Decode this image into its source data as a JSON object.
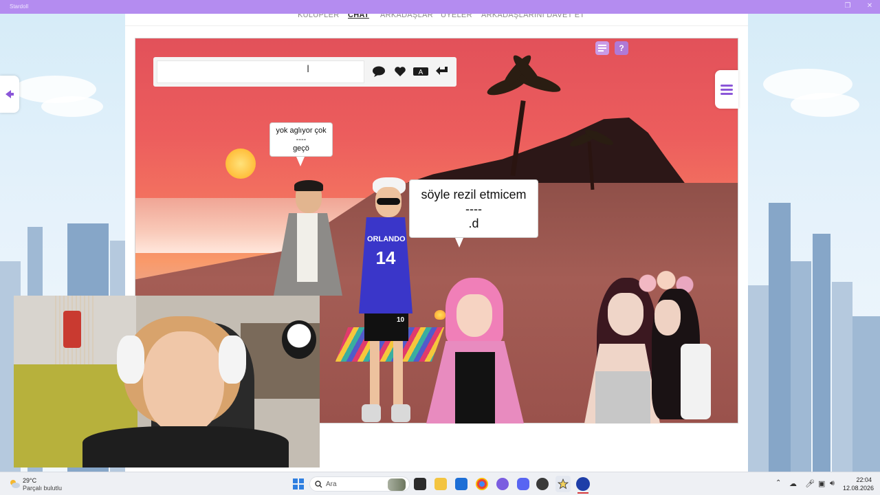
{
  "window": {
    "title": "Stardoll"
  },
  "nav": {
    "items": [
      {
        "label": "KULÜPLER",
        "active": false
      },
      {
        "label": "CHAT",
        "active": true
      },
      {
        "label": "ARKADAŞLAR",
        "active": false
      },
      {
        "label": "ÜYELER",
        "active": false
      },
      {
        "label": "ARKADAŞLARINI DAVET ET",
        "active": false
      }
    ]
  },
  "chat": {
    "input_value": "",
    "input_placeholder": "",
    "buttons": [
      {
        "name": "speech-bubble-icon"
      },
      {
        "name": "heart-icon"
      },
      {
        "name": "text-style-icon"
      },
      {
        "name": "send-icon"
      }
    ]
  },
  "scene_icons": [
    {
      "name": "notes-icon",
      "color": "#c99be6"
    },
    {
      "name": "help-icon",
      "label": "?",
      "color": "#b07ad6"
    }
  ],
  "bubbles": {
    "first": {
      "lines": [
        "yok aglıyor çok",
        "----",
        "geçö"
      ]
    },
    "second": {
      "lines": [
        "söyle rezil etmicem",
        "----",
        ".d"
      ]
    }
  },
  "avatars": [
    {
      "name": "avatar-man-grey-coat"
    },
    {
      "name": "avatar-boy-orlando-jersey",
      "jersey_text": "ORLANDO",
      "jersey_number": "14",
      "shorts_number": "10"
    },
    {
      "name": "avatar-girl-pink-jacket"
    },
    {
      "name": "avatar-girl-grey-top"
    },
    {
      "name": "avatar-girl-flower-crown"
    }
  ],
  "taskbar": {
    "weather_temp": "29°C",
    "weather_desc": "Parçalı bulutlu",
    "search_placeholder": "Ara",
    "clock_time": "22:04",
    "clock_date": "12.08.2026"
  },
  "colors": {
    "titlebar": "#b48cf0",
    "menu_accent": "#8b56d8",
    "sky_top": "#e2515a",
    "sun": "#ffbe3b"
  }
}
